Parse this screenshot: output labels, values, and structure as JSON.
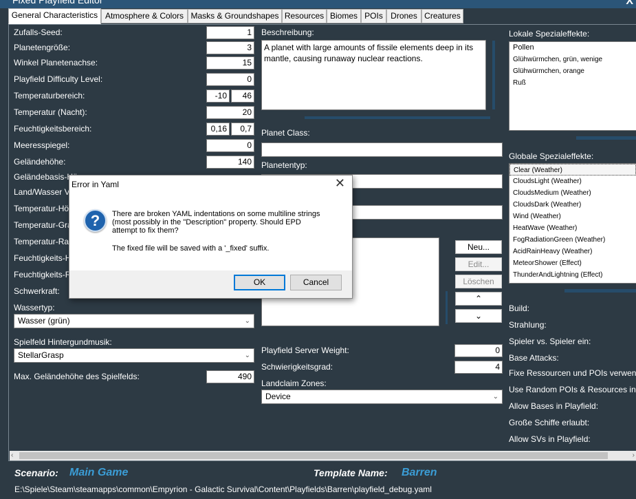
{
  "window": {
    "title": "Fixed Playfield Editor",
    "close": "X"
  },
  "tabs": [
    "General Characteristics",
    "Atmosphere & Colors",
    "Masks & Groundshapes",
    "Resources",
    "Biomes",
    "POIs",
    "Drones",
    "Creatures"
  ],
  "left_fields": [
    {
      "label": "Zufalls-Seed:",
      "value": "1"
    },
    {
      "label": "Planetengröße:",
      "value": "3"
    },
    {
      "label": "Winkel Planetenachse:",
      "value": "15"
    },
    {
      "label": "Playfield Difficulty Level:",
      "value": "0"
    },
    {
      "label": "Temperaturbereich:",
      "value_min": "-10",
      "value_max": "46"
    },
    {
      "label": "Temperatur (Nacht):",
      "value": "20"
    },
    {
      "label": "Feuchtigkeitsbereich:",
      "value_min": "0,16",
      "value_max": "0,7"
    },
    {
      "label": "Meeresspiegel:",
      "value": "0"
    },
    {
      "label": "Geländehöhe:",
      "value": "140"
    },
    {
      "label": "Geländebasis-Hö",
      "value": ""
    },
    {
      "label": "Land/Wasser Ve",
      "value": ""
    },
    {
      "label": "Temperatur-Hö",
      "value": ""
    },
    {
      "label": "Temperatur-Gra",
      "value": ""
    },
    {
      "label": "Temperatur-Rau",
      "value": ""
    },
    {
      "label": "Feuchtigkeits-H",
      "value": ""
    },
    {
      "label": "Feuchtigkeits-R",
      "value": ""
    },
    {
      "label": "Schwerkraft:",
      "value": ""
    }
  ],
  "wassertyp": {
    "label": "Wassertyp:",
    "value": "Wasser (grün)"
  },
  "musik": {
    "label": "Spielfeld Hintergundmusik:",
    "value": "StellarGrasp"
  },
  "max_height": {
    "label": "Max. Geländehöhe des Spielfelds:",
    "value": "490"
  },
  "beschreibung": {
    "label": "Beschreibung:",
    "value": "A planet with large amounts of fissile elements deep in its mantle, causing runaway nuclear reactions."
  },
  "planet_class": {
    "label": "Planet Class:",
    "value": ""
  },
  "planetentyp": {
    "label": "Planetentyp:",
    "value": ""
  },
  "list_buttons": {
    "new": "Neu...",
    "edit": "Edit...",
    "delete": "Löschen",
    "up": "⌃",
    "down": "⌄"
  },
  "server_weight": {
    "label": "Playfield Server Weight:",
    "value": "0"
  },
  "schwierigkeit": {
    "label": "Schwierigkeitsgrad:",
    "value": "4"
  },
  "landclaim": {
    "label": "Landclaim Zones:",
    "value": "Device"
  },
  "local_effects": {
    "label": "Lokale Spezialeffekte:",
    "items": [
      "Pollen",
      "Glühwürmchen, grün, wenige",
      "Glühwürmchen, orange",
      "Ruß"
    ]
  },
  "global_effects": {
    "label": "Globale Spezialeffekte:",
    "items": [
      "Clear (Weather)",
      "CloudsLight (Weather)",
      "CloudsMedium (Weather)",
      "CloudsDark (Weather)",
      "Wind (Weather)",
      "HeatWave (Weather)",
      "FogRadiationGreen (Weather)",
      "AcidRainHeavy (Weather)",
      "MeteorShower (Effect)",
      "ThunderAndLightning (Effect)"
    ]
  },
  "right_labels": [
    "Build:",
    "Strahlung:",
    "Spieler vs. Spieler ein:",
    "Base Attacks:",
    "Fixe Ressourcen und POIs verwende",
    "Use Random POIs & Resources in S",
    "Allow Bases in Playfield:",
    "Große Schiffe erlaubt:",
    "Allow SVs in Playfield:"
  ],
  "footer": {
    "scenario_label": "Scenario:",
    "scenario_value": "Main Game",
    "template_label": "Template Name:",
    "template_value": "Barren",
    "path": "E:\\Spiele\\Steam\\steamapps\\common\\Empyrion - Galactic Survival\\Content\\Playfields\\Barren\\playfield_debug.yaml"
  },
  "dialog": {
    "title": "Error in Yaml",
    "close": "✕",
    "message_lines": [
      "There are broken YAML indentations on some multiline strings",
      "(most possibly in the \"Description\" property. Should EPD",
      "attempt to fix them?"
    ],
    "note": "The fixed file will be saved with a '_fixed' suffix.",
    "ok": "OK",
    "cancel": "Cancel",
    "icon": "question-icon"
  },
  "colors": {
    "background": "#2d3a44",
    "accent": "#3b9dd6",
    "dialog_default": "#0078d7"
  }
}
